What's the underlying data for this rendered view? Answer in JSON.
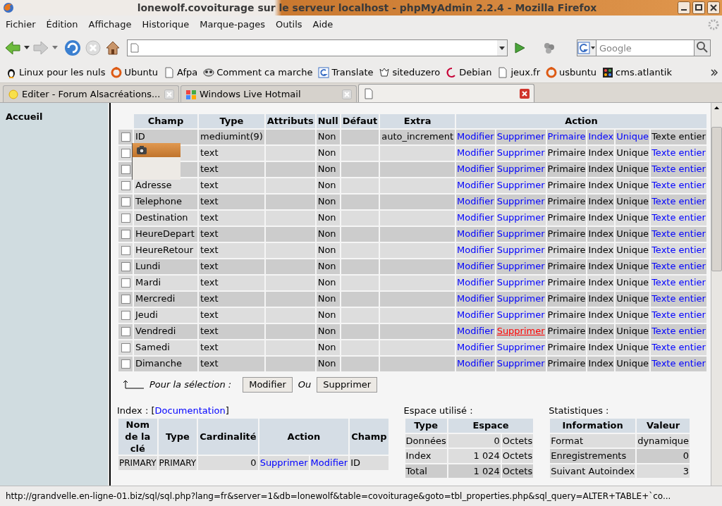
{
  "window": {
    "title": "lonewolf.covoiturage sur le serveur localhost - phpMyAdmin 2.2.4 - Mozilla Firefox"
  },
  "menu": [
    "Fichier",
    "Édition",
    "Affichage",
    "Historique",
    "Marque-pages",
    "Outils",
    "Aide"
  ],
  "search": {
    "placeholder": "Google"
  },
  "bookmarks": [
    {
      "label": "Linux pour les nuls",
      "kind": "penguin"
    },
    {
      "label": "Ubuntu",
      "kind": "ubuntu"
    },
    {
      "label": "Afpa",
      "kind": "page"
    },
    {
      "label": "Comment ca marche",
      "kind": "mask"
    },
    {
      "label": "Translate",
      "kind": "g"
    },
    {
      "label": "siteduzero",
      "kind": "zero"
    },
    {
      "label": "Debian",
      "kind": "debian"
    },
    {
      "label": "jeux.fr",
      "kind": "page"
    },
    {
      "label": "usbuntu",
      "kind": "ubuntu"
    },
    {
      "label": "cms.atlantik",
      "kind": "joomla"
    }
  ],
  "tabs": [
    {
      "label": "Editer - Forum Alsacréations...",
      "selected": false,
      "kind": "sun"
    },
    {
      "label": "Windows Live Hotmail",
      "selected": false,
      "kind": "windows"
    },
    {
      "selected": true,
      "kind": "page"
    }
  ],
  "sidebar": {
    "home": "Accueil"
  },
  "table": {
    "columns": [
      "Champ",
      "Type",
      "Attributs",
      "Null",
      "Défaut",
      "Extra",
      "Action"
    ],
    "rows": [
      {
        "field": "ID",
        "type": "mediumint(9)",
        "null": "Non",
        "extra": "auto_increment",
        "checked": false,
        "actions": [
          {
            "label": "Modifier",
            "link": true
          },
          {
            "label": "Supprimer",
            "link": true
          },
          {
            "label": "Primaire",
            "link": true
          },
          {
            "label": "Index",
            "link": true
          },
          {
            "label": "Unique",
            "link": true
          },
          {
            "label": "Texte entier",
            "link": false
          }
        ]
      },
      {
        "type": "text",
        "null": "Non",
        "checked": false,
        "actions": [
          {
            "label": "Modifier",
            "link": true
          },
          {
            "label": "Supprimer",
            "link": true
          },
          {
            "label": "Primaire",
            "link": false
          },
          {
            "label": "Index",
            "link": false
          },
          {
            "label": "Unique",
            "link": false
          },
          {
            "label": "Texte entier",
            "link": true
          }
        ]
      },
      {
        "type": "text",
        "null": "Non",
        "checked": false,
        "actions": [
          {
            "label": "Modifier",
            "link": true
          },
          {
            "label": "Supprimer",
            "link": true
          },
          {
            "label": "Primaire",
            "link": false
          },
          {
            "label": "Index",
            "link": false
          },
          {
            "label": "Unique",
            "link": false
          },
          {
            "label": "Texte entier",
            "link": true
          }
        ]
      },
      {
        "field": "Adresse",
        "type": "text",
        "null": "Non",
        "checked": false,
        "actions": [
          {
            "label": "Modifier",
            "link": true
          },
          {
            "label": "Supprimer",
            "link": true
          },
          {
            "label": "Primaire",
            "link": false
          },
          {
            "label": "Index",
            "link": false
          },
          {
            "label": "Unique",
            "link": false
          },
          {
            "label": "Texte entier",
            "link": true
          }
        ]
      },
      {
        "field": "Telephone",
        "type": "text",
        "null": "Non",
        "checked": false,
        "actions": [
          {
            "label": "Modifier",
            "link": true
          },
          {
            "label": "Supprimer",
            "link": true
          },
          {
            "label": "Primaire",
            "link": false
          },
          {
            "label": "Index",
            "link": false
          },
          {
            "label": "Unique",
            "link": false
          },
          {
            "label": "Texte entier",
            "link": true
          }
        ]
      },
      {
        "field": "Destination",
        "type": "text",
        "null": "Non",
        "checked": false,
        "actions": [
          {
            "label": "Modifier",
            "link": true
          },
          {
            "label": "Supprimer",
            "link": true
          },
          {
            "label": "Primaire",
            "link": false
          },
          {
            "label": "Index",
            "link": false
          },
          {
            "label": "Unique",
            "link": false
          },
          {
            "label": "Texte entier",
            "link": true
          }
        ]
      },
      {
        "field": "HeureDepart",
        "type": "text",
        "null": "Non",
        "checked": false,
        "actions": [
          {
            "label": "Modifier",
            "link": true
          },
          {
            "label": "Supprimer",
            "link": true
          },
          {
            "label": "Primaire",
            "link": false
          },
          {
            "label": "Index",
            "link": false
          },
          {
            "label": "Unique",
            "link": false
          },
          {
            "label": "Texte entier",
            "link": true
          }
        ]
      },
      {
        "field": "HeureRetour",
        "type": "text",
        "null": "Non",
        "checked": false,
        "actions": [
          {
            "label": "Modifier",
            "link": true
          },
          {
            "label": "Supprimer",
            "link": true
          },
          {
            "label": "Primaire",
            "link": false
          },
          {
            "label": "Index",
            "link": false
          },
          {
            "label": "Unique",
            "link": false
          },
          {
            "label": "Texte entier",
            "link": true
          }
        ]
      },
      {
        "field": "Lundi",
        "type": "text",
        "null": "Non",
        "checked": false,
        "actions": [
          {
            "label": "Modifier",
            "link": true
          },
          {
            "label": "Supprimer",
            "link": true
          },
          {
            "label": "Primaire",
            "link": false
          },
          {
            "label": "Index",
            "link": false
          },
          {
            "label": "Unique",
            "link": false
          },
          {
            "label": "Texte entier",
            "link": true
          }
        ]
      },
      {
        "field": "Mardi",
        "type": "text",
        "null": "Non",
        "checked": false,
        "actions": [
          {
            "label": "Modifier",
            "link": true
          },
          {
            "label": "Supprimer",
            "link": true
          },
          {
            "label": "Primaire",
            "link": false
          },
          {
            "label": "Index",
            "link": false
          },
          {
            "label": "Unique",
            "link": false
          },
          {
            "label": "Texte entier",
            "link": true
          }
        ]
      },
      {
        "field": "Mercredi",
        "type": "text",
        "null": "Non",
        "checked": false,
        "actions": [
          {
            "label": "Modifier",
            "link": true
          },
          {
            "label": "Supprimer",
            "link": true
          },
          {
            "label": "Primaire",
            "link": false
          },
          {
            "label": "Index",
            "link": false
          },
          {
            "label": "Unique",
            "link": false
          },
          {
            "label": "Texte entier",
            "link": true
          }
        ]
      },
      {
        "field": "Jeudi",
        "type": "text",
        "null": "Non",
        "checked": false,
        "actions": [
          {
            "label": "Modifier",
            "link": true
          },
          {
            "label": "Supprimer",
            "link": true
          },
          {
            "label": "Primaire",
            "link": false
          },
          {
            "label": "Index",
            "link": false
          },
          {
            "label": "Unique",
            "link": false
          },
          {
            "label": "Texte entier",
            "link": true
          }
        ]
      },
      {
        "field": "Vendredi",
        "type": "text",
        "null": "Non",
        "checked": false,
        "actions": [
          {
            "label": "Modifier",
            "link": true
          },
          {
            "label": "Supprimer",
            "link": true,
            "hover": true
          },
          {
            "label": "Primaire",
            "link": false
          },
          {
            "label": "Index",
            "link": false
          },
          {
            "label": "Unique",
            "link": false
          },
          {
            "label": "Texte entier",
            "link": true
          }
        ]
      },
      {
        "field": "Samedi",
        "type": "text",
        "null": "Non",
        "checked": false,
        "actions": [
          {
            "label": "Modifier",
            "link": true
          },
          {
            "label": "Supprimer",
            "link": true
          },
          {
            "label": "Primaire",
            "link": false
          },
          {
            "label": "Index",
            "link": false
          },
          {
            "label": "Unique",
            "link": false
          },
          {
            "label": "Texte entier",
            "link": true
          }
        ]
      },
      {
        "field": "Dimanche",
        "type": "text",
        "null": "Non",
        "checked": false,
        "actions": [
          {
            "label": "Modifier",
            "link": true
          },
          {
            "label": "Supprimer",
            "link": true
          },
          {
            "label": "Primaire",
            "link": false
          },
          {
            "label": "Index",
            "link": false
          },
          {
            "label": "Unique",
            "link": false
          },
          {
            "label": "Texte entier",
            "link": true
          }
        ]
      }
    ]
  },
  "selection": {
    "label": "Pour la sélection :",
    "buttons": [
      "Modifier",
      "Supprimer"
    ],
    "or": "Ou"
  },
  "index": {
    "prefix": "Index : [",
    "link": "Documentation",
    "suffix": "]",
    "columns": [
      "Nom de la clé",
      "Type",
      "Cardinalité",
      "Action",
      "Champ"
    ],
    "rows": [
      {
        "name": "PRIMARY",
        "type": "PRIMARY",
        "cardinality": "0",
        "actions": [
          "Supprimer",
          "Modifier"
        ],
        "field": "ID"
      }
    ]
  },
  "space": {
    "title": "Espace utilisé :",
    "columns": [
      "Type",
      "Espace"
    ],
    "rows": [
      {
        "type": "Données",
        "value": "0",
        "unit": "Octets"
      },
      {
        "type": "Index",
        "value": "1 024",
        "unit": "Octets"
      },
      {
        "type": "Total",
        "value": "1 024",
        "unit": "Octets"
      }
    ]
  },
  "stats": {
    "title": "Statistiques :",
    "columns": [
      "Information",
      "Valeur"
    ],
    "rows": [
      {
        "info": "Format",
        "value": "dynamique",
        "kind": "text"
      },
      {
        "info": "Enregistrements",
        "value": "0",
        "kind": "number"
      },
      {
        "info": "Suivant Autoindex",
        "value": "3",
        "kind": "number"
      }
    ]
  },
  "status_bar": "http://grandvelle.en-ligne-01.biz/sql/sql.php?lang=fr&server=1&db=lonewolf&table=covoiturage&goto=tbl_properties.php&sql_query=ALTER+TABLE+`co..."
}
